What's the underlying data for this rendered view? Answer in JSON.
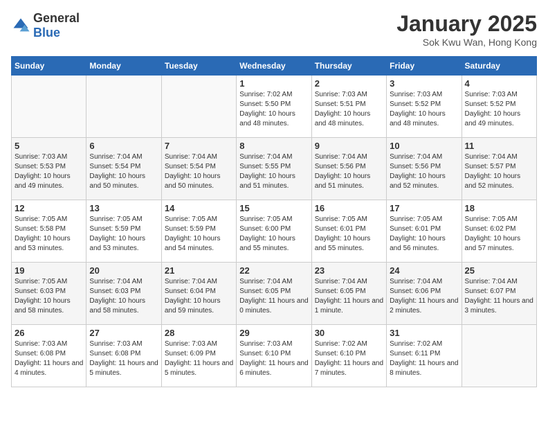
{
  "logo": {
    "general": "General",
    "blue": "Blue"
  },
  "title": "January 2025",
  "subtitle": "Sok Kwu Wan, Hong Kong",
  "days_of_week": [
    "Sunday",
    "Monday",
    "Tuesday",
    "Wednesday",
    "Thursday",
    "Friday",
    "Saturday"
  ],
  "weeks": [
    [
      {
        "day": "",
        "info": ""
      },
      {
        "day": "",
        "info": ""
      },
      {
        "day": "",
        "info": ""
      },
      {
        "day": "1",
        "info": "Sunrise: 7:02 AM\nSunset: 5:50 PM\nDaylight: 10 hours\nand 48 minutes."
      },
      {
        "day": "2",
        "info": "Sunrise: 7:03 AM\nSunset: 5:51 PM\nDaylight: 10 hours\nand 48 minutes."
      },
      {
        "day": "3",
        "info": "Sunrise: 7:03 AM\nSunset: 5:52 PM\nDaylight: 10 hours\nand 48 minutes."
      },
      {
        "day": "4",
        "info": "Sunrise: 7:03 AM\nSunset: 5:52 PM\nDaylight: 10 hours\nand 49 minutes."
      }
    ],
    [
      {
        "day": "5",
        "info": "Sunrise: 7:03 AM\nSunset: 5:53 PM\nDaylight: 10 hours\nand 49 minutes."
      },
      {
        "day": "6",
        "info": "Sunrise: 7:04 AM\nSunset: 5:54 PM\nDaylight: 10 hours\nand 50 minutes."
      },
      {
        "day": "7",
        "info": "Sunrise: 7:04 AM\nSunset: 5:54 PM\nDaylight: 10 hours\nand 50 minutes."
      },
      {
        "day": "8",
        "info": "Sunrise: 7:04 AM\nSunset: 5:55 PM\nDaylight: 10 hours\nand 51 minutes."
      },
      {
        "day": "9",
        "info": "Sunrise: 7:04 AM\nSunset: 5:56 PM\nDaylight: 10 hours\nand 51 minutes."
      },
      {
        "day": "10",
        "info": "Sunrise: 7:04 AM\nSunset: 5:56 PM\nDaylight: 10 hours\nand 52 minutes."
      },
      {
        "day": "11",
        "info": "Sunrise: 7:04 AM\nSunset: 5:57 PM\nDaylight: 10 hours\nand 52 minutes."
      }
    ],
    [
      {
        "day": "12",
        "info": "Sunrise: 7:05 AM\nSunset: 5:58 PM\nDaylight: 10 hours\nand 53 minutes."
      },
      {
        "day": "13",
        "info": "Sunrise: 7:05 AM\nSunset: 5:59 PM\nDaylight: 10 hours\nand 53 minutes."
      },
      {
        "day": "14",
        "info": "Sunrise: 7:05 AM\nSunset: 5:59 PM\nDaylight: 10 hours\nand 54 minutes."
      },
      {
        "day": "15",
        "info": "Sunrise: 7:05 AM\nSunset: 6:00 PM\nDaylight: 10 hours\nand 55 minutes."
      },
      {
        "day": "16",
        "info": "Sunrise: 7:05 AM\nSunset: 6:01 PM\nDaylight: 10 hours\nand 55 minutes."
      },
      {
        "day": "17",
        "info": "Sunrise: 7:05 AM\nSunset: 6:01 PM\nDaylight: 10 hours\nand 56 minutes."
      },
      {
        "day": "18",
        "info": "Sunrise: 7:05 AM\nSunset: 6:02 PM\nDaylight: 10 hours\nand 57 minutes."
      }
    ],
    [
      {
        "day": "19",
        "info": "Sunrise: 7:05 AM\nSunset: 6:03 PM\nDaylight: 10 hours\nand 58 minutes."
      },
      {
        "day": "20",
        "info": "Sunrise: 7:04 AM\nSunset: 6:03 PM\nDaylight: 10 hours\nand 58 minutes."
      },
      {
        "day": "21",
        "info": "Sunrise: 7:04 AM\nSunset: 6:04 PM\nDaylight: 10 hours\nand 59 minutes."
      },
      {
        "day": "22",
        "info": "Sunrise: 7:04 AM\nSunset: 6:05 PM\nDaylight: 11 hours\nand 0 minutes."
      },
      {
        "day": "23",
        "info": "Sunrise: 7:04 AM\nSunset: 6:05 PM\nDaylight: 11 hours\nand 1 minute."
      },
      {
        "day": "24",
        "info": "Sunrise: 7:04 AM\nSunset: 6:06 PM\nDaylight: 11 hours\nand 2 minutes."
      },
      {
        "day": "25",
        "info": "Sunrise: 7:04 AM\nSunset: 6:07 PM\nDaylight: 11 hours\nand 3 minutes."
      }
    ],
    [
      {
        "day": "26",
        "info": "Sunrise: 7:03 AM\nSunset: 6:08 PM\nDaylight: 11 hours\nand 4 minutes."
      },
      {
        "day": "27",
        "info": "Sunrise: 7:03 AM\nSunset: 6:08 PM\nDaylight: 11 hours\nand 5 minutes."
      },
      {
        "day": "28",
        "info": "Sunrise: 7:03 AM\nSunset: 6:09 PM\nDaylight: 11 hours\nand 5 minutes."
      },
      {
        "day": "29",
        "info": "Sunrise: 7:03 AM\nSunset: 6:10 PM\nDaylight: 11 hours\nand 6 minutes."
      },
      {
        "day": "30",
        "info": "Sunrise: 7:02 AM\nSunset: 6:10 PM\nDaylight: 11 hours\nand 7 minutes."
      },
      {
        "day": "31",
        "info": "Sunrise: 7:02 AM\nSunset: 6:11 PM\nDaylight: 11 hours\nand 8 minutes."
      },
      {
        "day": "",
        "info": ""
      }
    ]
  ]
}
